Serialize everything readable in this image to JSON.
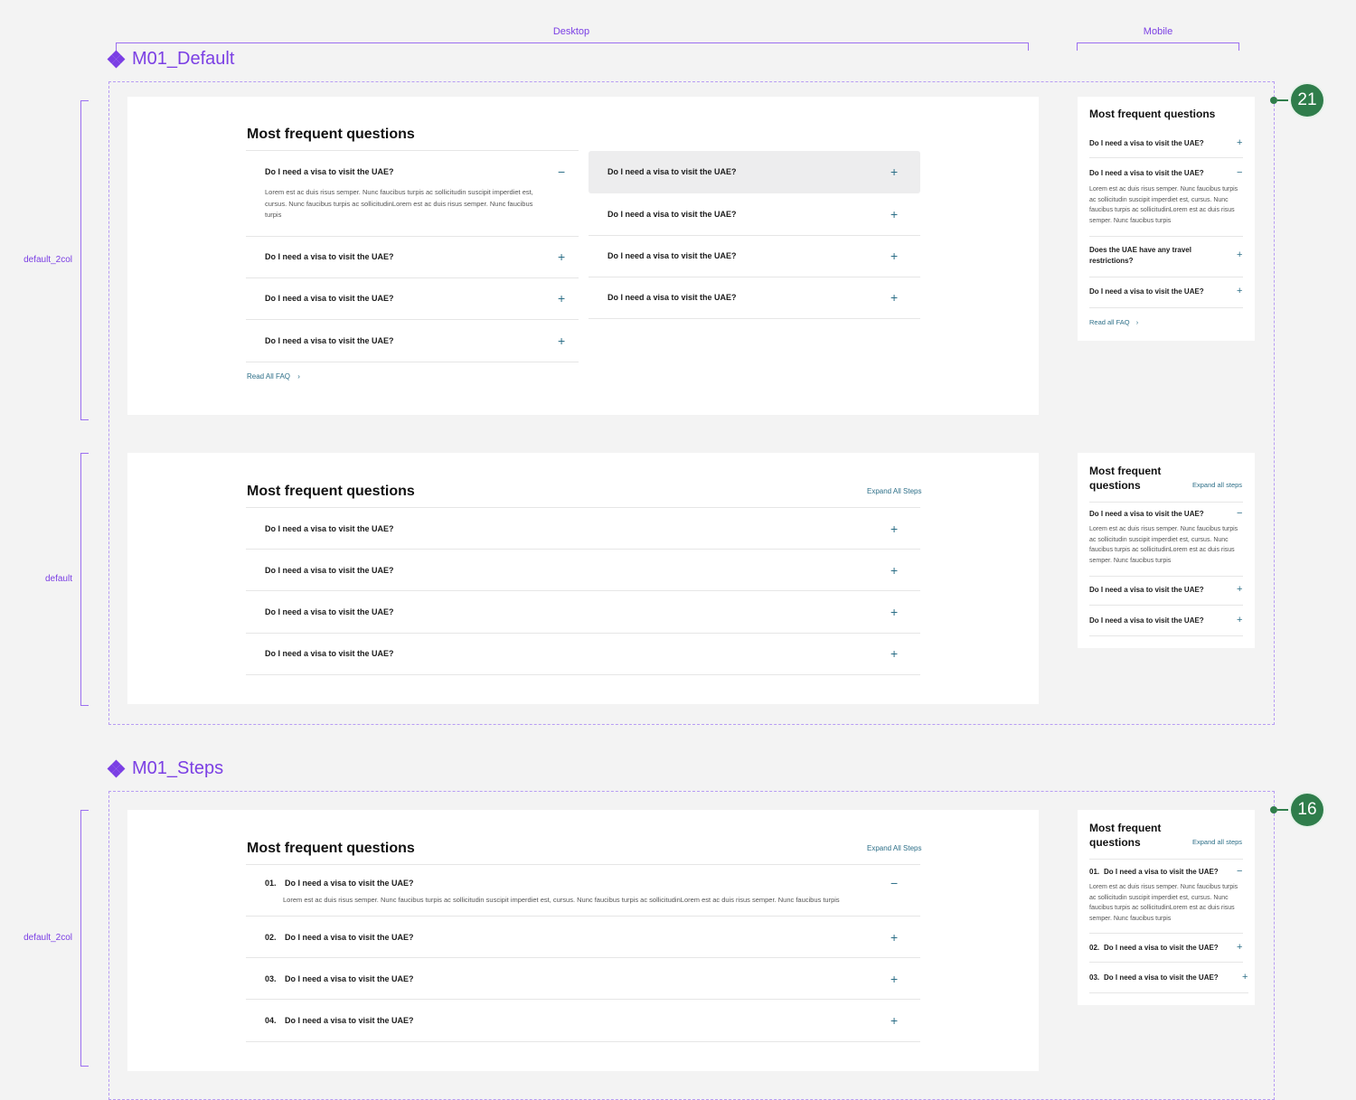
{
  "header": {
    "desktop_label": "Desktop",
    "mobile_label": "Mobile"
  },
  "components": {
    "default": {
      "title": "M01_Default",
      "badge": "21"
    },
    "steps": {
      "title": "M01_Steps",
      "badge": "16"
    }
  },
  "row_labels": {
    "default_2col": "default_2col",
    "default": "default",
    "steps_2col": "default_2col"
  },
  "faq": {
    "title": "Most frequent questions",
    "question": "Do I need a visa to visit the UAE?",
    "answer_desktop": "Lorem est ac duis risus semper. Nunc faucibus turpis ac sollicitudin suscipit imperdiet est, cursus.  Nunc faucibus turpis ac sollicitudinLorem est ac duis risus semper. Nunc faucibus turpis",
    "answer_wide": "Lorem est ac duis risus semper. Nunc faucibus turpis ac sollicitudin suscipit imperdiet est, cursus.  Nunc faucibus turpis ac sollicitudinLorem est ac duis risus semper. Nunc faucibus turpis",
    "answer_mobile": "Lorem est ac duis risus semper. Nunc faucibus turpis ac sollicitudin suscipit imperdiet est, cursus.  Nunc faucibus turpis ac sollicitudinLorem est ac duis risus semper. Nunc faucibus turpis",
    "travel_question": "Does the UAE have any travel restrictions?",
    "read_all_desktop": "Read All FAQ",
    "read_all_mobile": "Read all FAQ",
    "expand_desktop": "Expand All Steps",
    "expand_mobile": "Expand all steps",
    "mobile_title_line1": "Most frequent",
    "mobile_title_line2": "questions",
    "steps": [
      "01.",
      "02.",
      "03.",
      "04."
    ]
  },
  "icons": {
    "plus": "+",
    "minus": "−",
    "chevron": "›"
  },
  "colors": {
    "accent_purple": "#7b3fe4",
    "link_teal": "#2d6f88",
    "badge_green": "#2f7d4b"
  }
}
